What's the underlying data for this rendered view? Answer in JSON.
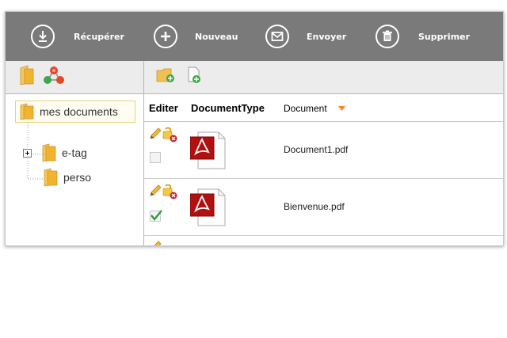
{
  "toolbar": {
    "items": [
      {
        "label": "Récupérer",
        "icon": "download-icon"
      },
      {
        "label": "Nouveau",
        "icon": "plus-icon"
      },
      {
        "label": "Envoyer",
        "icon": "envelope-icon"
      },
      {
        "label": "Supprimer",
        "icon": "trash-icon"
      }
    ]
  },
  "tree": {
    "root": "mes documents",
    "children": [
      {
        "label": "e-tag"
      },
      {
        "label": "perso"
      }
    ]
  },
  "grid": {
    "headers": {
      "edit": "Editer",
      "type": "DocumentType",
      "document": "Document"
    },
    "rows": [
      {
        "file": "Document1.pdf",
        "checked": false
      },
      {
        "file": "Bienvenue.pdf",
        "checked": true
      }
    ]
  },
  "colors": {
    "toolbar_bg": "#7a7a7a",
    "pane_bar_bg": "#ececec",
    "folder": "#f0b430",
    "pdf_red": "#b01010",
    "sort_arrow": "#f08a24"
  }
}
